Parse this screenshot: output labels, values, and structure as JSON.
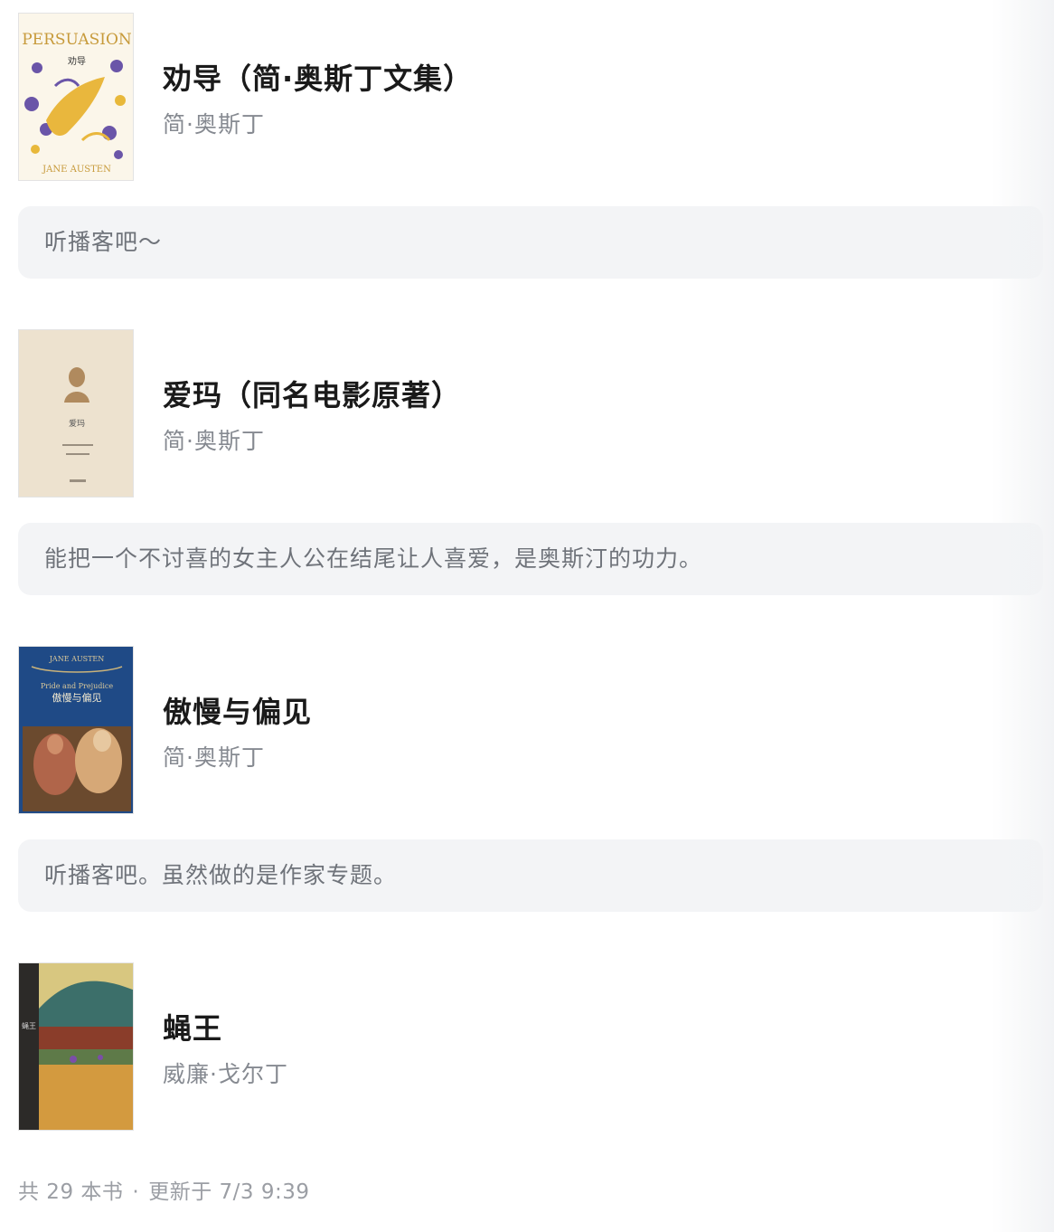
{
  "books": [
    {
      "title": "劝导（简·奥斯丁文集）",
      "author": "简·奥斯丁",
      "cover_icon": "persuasion-cover",
      "cover_text": [
        "PERSUASION",
        "劝导",
        "JANE AUSTEN"
      ],
      "note": "听播客吧～"
    },
    {
      "title": "爱玛（同名电影原著）",
      "author": "简·奥斯丁",
      "cover_icon": "emma-cover",
      "cover_text": [
        "爱玛"
      ],
      "note": "能把一个不讨喜的女主人公在结尾让人喜爱，是奥斯汀的功力。"
    },
    {
      "title": "傲慢与偏见",
      "author": "简·奥斯丁",
      "cover_icon": "pride-and-prejudice-cover",
      "cover_text": [
        "JANE AUSTEN",
        "Pride and Prejudice",
        "傲慢与偏见"
      ],
      "note": "听播客吧。虽然做的是作家专题。"
    },
    {
      "title": "蝇王",
      "author": "威廉·戈尔丁",
      "cover_icon": "lord-of-the-flies-cover",
      "cover_text": [
        "蝇王"
      ]
    }
  ],
  "footer": {
    "count": "共 29 本书",
    "separator": "·",
    "updated": "更新于 7/3 9:39"
  },
  "colors": {
    "title": "#1a1a1a",
    "author": "#868a91",
    "note_bg": "#f3f4f6",
    "note_text": "#6f737a",
    "footer": "#9b9ea4"
  }
}
